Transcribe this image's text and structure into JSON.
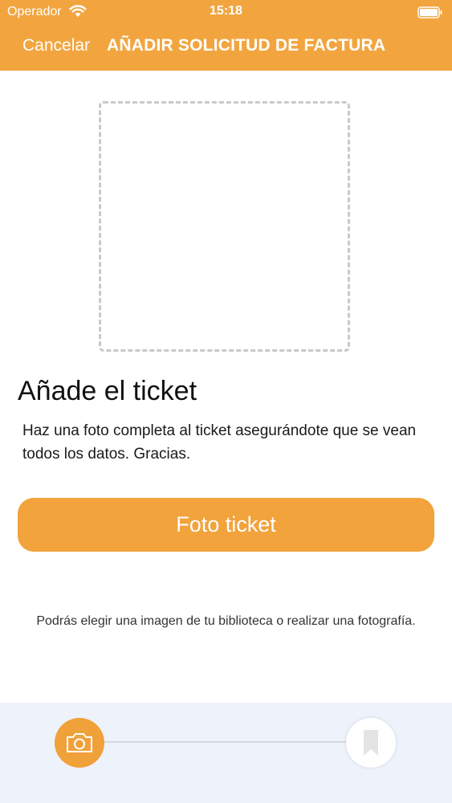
{
  "status_bar": {
    "carrier": "Operador",
    "time": "15:18"
  },
  "nav": {
    "cancel_label": "Cancelar",
    "title": "AÑADIR SOLICITUD DE FACTURA"
  },
  "content": {
    "section_title": "Añade el ticket",
    "instructions": "Haz una foto completa al ticket asegurándote que se vean todos los datos. Gracias.",
    "photo_button_label": "Foto ticket",
    "hint": "Podrás elegir una imagen de tu biblioteca o realizar una fotografía."
  },
  "stepper": {
    "steps": [
      {
        "icon": "camera-icon",
        "active": true
      },
      {
        "icon": "bookmark-icon",
        "active": false
      }
    ]
  },
  "colors": {
    "accent": "#f2a53f",
    "stepper_background": "#eef2fa",
    "placeholder_border": "#c9c9c9"
  }
}
